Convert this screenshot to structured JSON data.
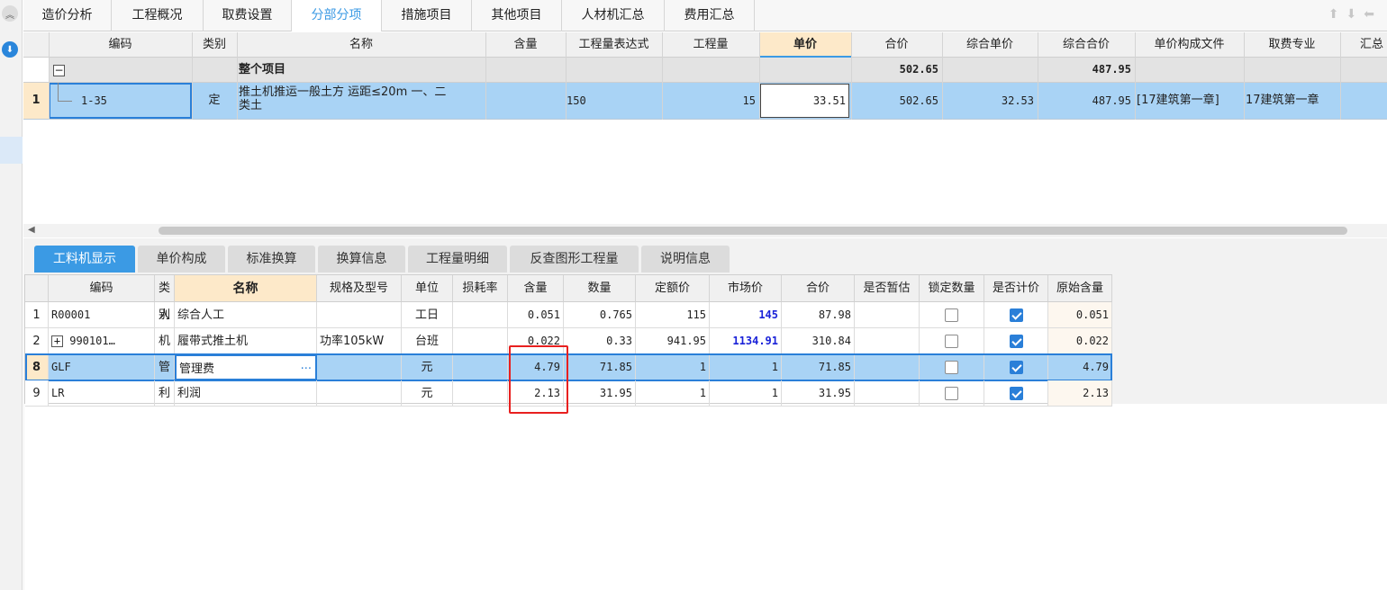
{
  "top_tabs": [
    "造价分析",
    "工程概况",
    "取费设置",
    "分部分项",
    "措施项目",
    "其他项目",
    "人材机汇总",
    "费用汇总"
  ],
  "upper_headers": [
    "编码",
    "类别",
    "名称",
    "含量",
    "工程量表达式",
    "工程量",
    "单价",
    "合价",
    "综合单价",
    "综合合价",
    "单价构成文件",
    "取费专业",
    "汇总"
  ],
  "total_row": {
    "label": "整个项目",
    "total_price": "502.65",
    "comp_total": "487.95"
  },
  "upper_row": {
    "num": "1",
    "code": "1-35",
    "type": "定",
    "name_line1": "推土机推运一般土方 运距≤20m 一、二",
    "name_line2": "类土",
    "expr": "150",
    "quantity": "15",
    "unit_price": "33.51",
    "total_price": "502.65",
    "comp_unit": "32.53",
    "comp_total": "487.95",
    "price_file": "[17建筑第一章]",
    "fee_type": "17建筑第一章"
  },
  "bottom_tabs": [
    "工料机显示",
    "单价构成",
    "标准换算",
    "换算信息",
    "工程量明细",
    "反查图形工程量",
    "说明信息"
  ],
  "lower_headers": [
    "编码",
    "类别",
    "名称",
    "规格及型号",
    "单位",
    "损耗率",
    "含量",
    "数量",
    "定额价",
    "市场价",
    "合价",
    "是否暂估",
    "锁定数量",
    "是否计价",
    "原始含量"
  ],
  "lower_rows": [
    {
      "num": "1",
      "code": "R00001",
      "type": "人",
      "name": "综合人工",
      "spec": "",
      "unit": "工日",
      "loss": "",
      "content": "0.051",
      "qty": "0.765",
      "base_price": "115",
      "market_price": "145",
      "total": "87.98",
      "orig": "0.051"
    },
    {
      "num": "2",
      "expand": "+",
      "code": "990101…",
      "type": "机",
      "name": "履带式推土机",
      "spec": "功率105kW",
      "unit": "台班",
      "loss": "",
      "content": "0.022",
      "qty": "0.33",
      "base_price": "941.95",
      "market_price": "1134.91",
      "total": "310.84",
      "orig": "0.022"
    },
    {
      "num": "8",
      "code": "GLF",
      "type": "管",
      "name": "管理费",
      "more": "···",
      "spec": "",
      "unit": "元",
      "loss": "",
      "content": "4.79",
      "qty": "71.85",
      "base_price": "1",
      "market_price": "1",
      "total": "71.85",
      "orig": "4.79"
    },
    {
      "num": "9",
      "code": "LR",
      "type": "利",
      "name": "利润",
      "spec": "",
      "unit": "元",
      "loss": "",
      "content": "2.13",
      "qty": "31.95",
      "base_price": "1",
      "market_price": "1",
      "total": "31.95",
      "orig": "2.13"
    }
  ],
  "icons": {
    "collapse": "chevron-double-up-icon",
    "down": "download-icon",
    "nav": "up-down-arrows-icon"
  },
  "colors": {
    "accent": "#3b9ae4",
    "selection": "#a9d3f5",
    "highlight": "#e8201f",
    "market_price": "#1a22d8"
  }
}
